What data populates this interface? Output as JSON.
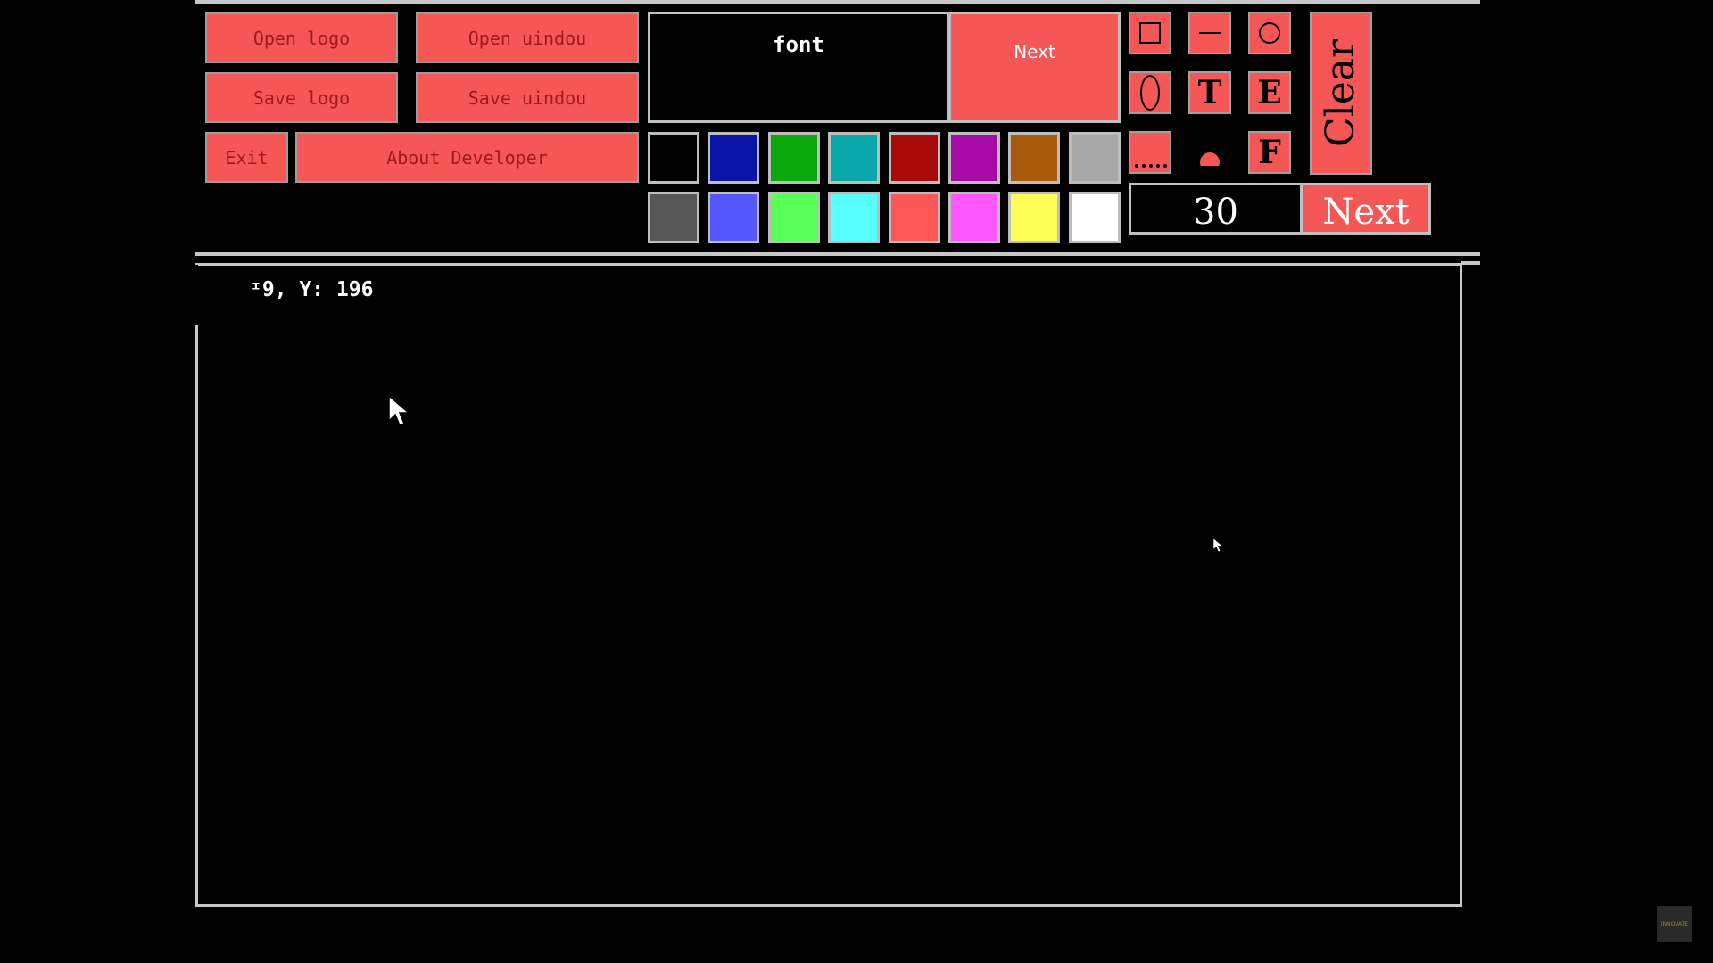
{
  "menu": {
    "open_logo": "Open logo",
    "open_window": "Open uindou",
    "save_logo": "Save logo",
    "save_window": "Save uindou",
    "exit": "Exit",
    "about": "About Developer"
  },
  "font_panel": {
    "label": "font",
    "next": "Next"
  },
  "palette": [
    {
      "name": "black",
      "color": "#000000"
    },
    {
      "name": "blue",
      "color": "#0a14a8"
    },
    {
      "name": "green",
      "color": "#0aa80a"
    },
    {
      "name": "cyan",
      "color": "#0aa8a8"
    },
    {
      "name": "red",
      "color": "#a80a0a"
    },
    {
      "name": "magenta",
      "color": "#a80aa8"
    },
    {
      "name": "brown",
      "color": "#a85a0a"
    },
    {
      "name": "light-gray",
      "color": "#a8a8a8"
    },
    {
      "name": "dark-gray",
      "color": "#575757"
    },
    {
      "name": "light-blue",
      "color": "#5757ff"
    },
    {
      "name": "light-green",
      "color": "#57ff57"
    },
    {
      "name": "light-cyan",
      "color": "#57ffff"
    },
    {
      "name": "light-red",
      "color": "#ff5757"
    },
    {
      "name": "light-magenta",
      "color": "#ff57ff"
    },
    {
      "name": "yellow",
      "color": "#ffff57"
    },
    {
      "name": "white",
      "color": "#ffffff"
    }
  ],
  "tools": {
    "rectangle": "rectangle-icon",
    "line": "line-icon",
    "circle": "circle-icon",
    "ellipse": "ellipse-icon",
    "text_letter": "T",
    "eraser_letter": "E",
    "dotted": "dotted-line-icon",
    "brush": "dot-brush-icon",
    "fill_letter": "F",
    "clear": "Clear"
  },
  "size_panel": {
    "value": "30",
    "next": "Next"
  },
  "status": {
    "coords": "ᶦ9, Y: 196"
  },
  "accent_color": "#f55757",
  "watermark": "INNOVATE"
}
